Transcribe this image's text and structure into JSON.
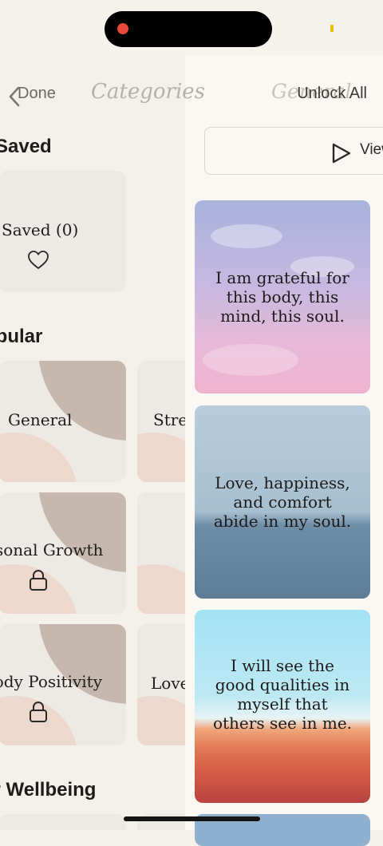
{
  "header": {
    "done_label": "Done",
    "title": "Categories",
    "ghost_title": "General",
    "unlock_label": "Unlock All"
  },
  "view_button": {
    "label": "View"
  },
  "sections": {
    "saved": "Saved",
    "popular": "Popular",
    "wellbeing": "Your Wellbeing"
  },
  "tiles": {
    "saved": "Saved (0)",
    "general": "General",
    "stress": "Stress",
    "personal_growth": "Personal Growth",
    "body_positivity": "Body Positivity",
    "love": "Love"
  },
  "cards": [
    {
      "text": "I am grateful for this body, this mind, this soul."
    },
    {
      "text": "Love, happiness, and comfort abide in my soul."
    },
    {
      "text": "I will see the good qualities in myself that others see in me."
    }
  ],
  "colors": {
    "record_dot": "#e8473d",
    "background": "#f6f2ec",
    "tile_accent": "#c6b8ae"
  },
  "icons": [
    "chevron-left-icon",
    "play-icon",
    "heart-icon",
    "lock-icon"
  ]
}
